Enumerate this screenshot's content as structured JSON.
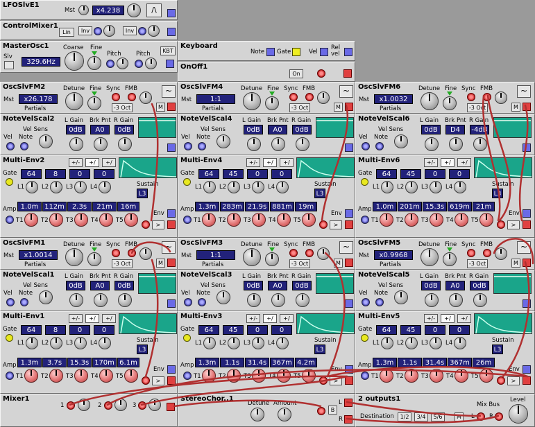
{
  "lfo": {
    "title": "LFOSlvE1",
    "mst": "Mst",
    "value": "x4.238"
  },
  "cmix": {
    "title": "ControlMixer1",
    "lin": "Lin",
    "inv1": "Inv",
    "inv2": "Inv"
  },
  "master": {
    "title": "MasterOsc1",
    "slv": "Slv",
    "coarse": "Coarse",
    "fine": "Fine",
    "freq": "329.6Hz",
    "pitch1": "Pitch",
    "pitch2": "Pitch",
    "kbt": "KBT"
  },
  "kbd": {
    "title": "Keyboard",
    "note": "Note",
    "gate": "Gate",
    "vel": "Vel",
    "relvel": "Rel vel"
  },
  "onoff": {
    "title": "OnOff1",
    "on": "On"
  },
  "labels": {
    "detune": "Detune",
    "fine": "Fine",
    "sync": "Sync",
    "fmb": "FMB",
    "mst": "Mst",
    "partials": "Partials",
    "oct": "-3 Oct",
    "m": "M",
    "vsens": "Vel Sens",
    "vel": "Vel",
    "note": "Note",
    "lgain": "L Gain",
    "brk": "Brk Pnt",
    "rgain": "R Gain",
    "gate": "Gate",
    "sustain": "Sustain",
    "amp": "Amp",
    "env": "Env",
    "l1": "L1",
    "l2": "L2",
    "l3": "L3",
    "l4": "L4",
    "t1": "T1",
    "t2": "T2",
    "t3": "T3",
    "t4": "T4",
    "t5": "T5"
  },
  "osc": {
    "fm2": {
      "title": "OscSlvFM2",
      "ratio": "x26.178"
    },
    "fm4": {
      "title": "OscSlvFM4",
      "ratio": "1:1"
    },
    "fm6": {
      "title": "OscSlvFM6",
      "ratio": "x1.0032"
    },
    "fm1": {
      "title": "OscSlvFM1",
      "ratio": "x1.0014"
    },
    "fm3": {
      "title": "OscSlvFM3",
      "ratio": "1:1"
    },
    "fm5": {
      "title": "OscSlvFM5",
      "ratio": "x0.9968"
    }
  },
  "nvs": {
    "s2": {
      "title": "NoteVelScal2",
      "lg": "0dB",
      "bp": "A0",
      "rg": "0dB"
    },
    "s4": {
      "title": "NoteVelScal4",
      "lg": "0dB",
      "bp": "A0",
      "rg": "0dB"
    },
    "s6": {
      "title": "NoteVelScal6",
      "lg": "0dB",
      "bp": "D4",
      "rg": "-4dB"
    },
    "s1": {
      "title": "NoteVelScal1",
      "lg": "0dB",
      "bp": "A0",
      "rg": "0dB"
    },
    "s3": {
      "title": "NoteVelScal3",
      "lg": "0dB",
      "bp": "A0",
      "rg": "0dB"
    },
    "s5": {
      "title": "NoteVelScal5",
      "lg": "0dB",
      "bp": "A0",
      "rg": "0dB"
    }
  },
  "env": {
    "e2": {
      "title": "Multi-Env2",
      "l1": "64",
      "l2": "8",
      "l3": "0",
      "l4": "0",
      "sus": "L3",
      "t1": "1.0m",
      "t2": "112m",
      "t3": "2.3s",
      "t4": "21m",
      "t5": "16m"
    },
    "e4": {
      "title": "Multi-Env4",
      "l1": "64",
      "l2": "45",
      "l3": "0",
      "l4": "0",
      "sus": "L3",
      "t1": "1.3m",
      "t2": "283m",
      "t3": "21.9s",
      "t4": "881m",
      "t5": "19m"
    },
    "e6": {
      "title": "Multi-Env6",
      "l1": "64",
      "l2": "45",
      "l3": "0",
      "l4": "0",
      "sus": "L3",
      "t1": "1.0m",
      "t2": "201m",
      "t3": "15.3s",
      "t4": "619m",
      "t5": "21m"
    },
    "e1": {
      "title": "Multi-Env1",
      "l1": "64",
      "l2": "8",
      "l3": "0",
      "l4": "0",
      "sus": "L3",
      "t1": "1.3m",
      "t2": "3.7s",
      "t3": "15.3s",
      "t4": "170m",
      "t5": "6.1m"
    },
    "e3": {
      "title": "Multi-Env3",
      "l1": "64",
      "l2": "45",
      "l3": "0",
      "l4": "0",
      "sus": "L3",
      "t1": "1.3m",
      "t2": "1.1s",
      "t3": "31.4s",
      "t4": "367m",
      "t5": "4.2m"
    },
    "e5": {
      "title": "Multi-Env5",
      "l1": "64",
      "l2": "45",
      "l3": "0",
      "l4": "0",
      "sus": "L3",
      "t1": "1.3m",
      "t2": "1.1s",
      "t3": "31.4s",
      "t4": "367m",
      "t5": "26m"
    }
  },
  "mixer": {
    "title": "Mixer1",
    "in1": "1",
    "in2": "2",
    "in3": "3"
  },
  "stereo": {
    "title": "StereoChor..1",
    "detune": "Detune",
    "amount": "Amount",
    "b": "B",
    "l": "L",
    "r": "R"
  },
  "outs": {
    "title": "2 outputs1",
    "mixbus": "Mix Bus",
    "level": "Level",
    "dest": "Destination",
    "d1": "1/2",
    "d2": "3/4",
    "d3": "5/6",
    "m": "M",
    "l": "L",
    "r": "R"
  },
  "colors": {
    "panel": "#d4d4d4",
    "display": "#22227a",
    "cable": "#b03030",
    "scope": "#1aa58a",
    "blue_jack": "#6a6ae6",
    "red_jack": "#e04040"
  }
}
